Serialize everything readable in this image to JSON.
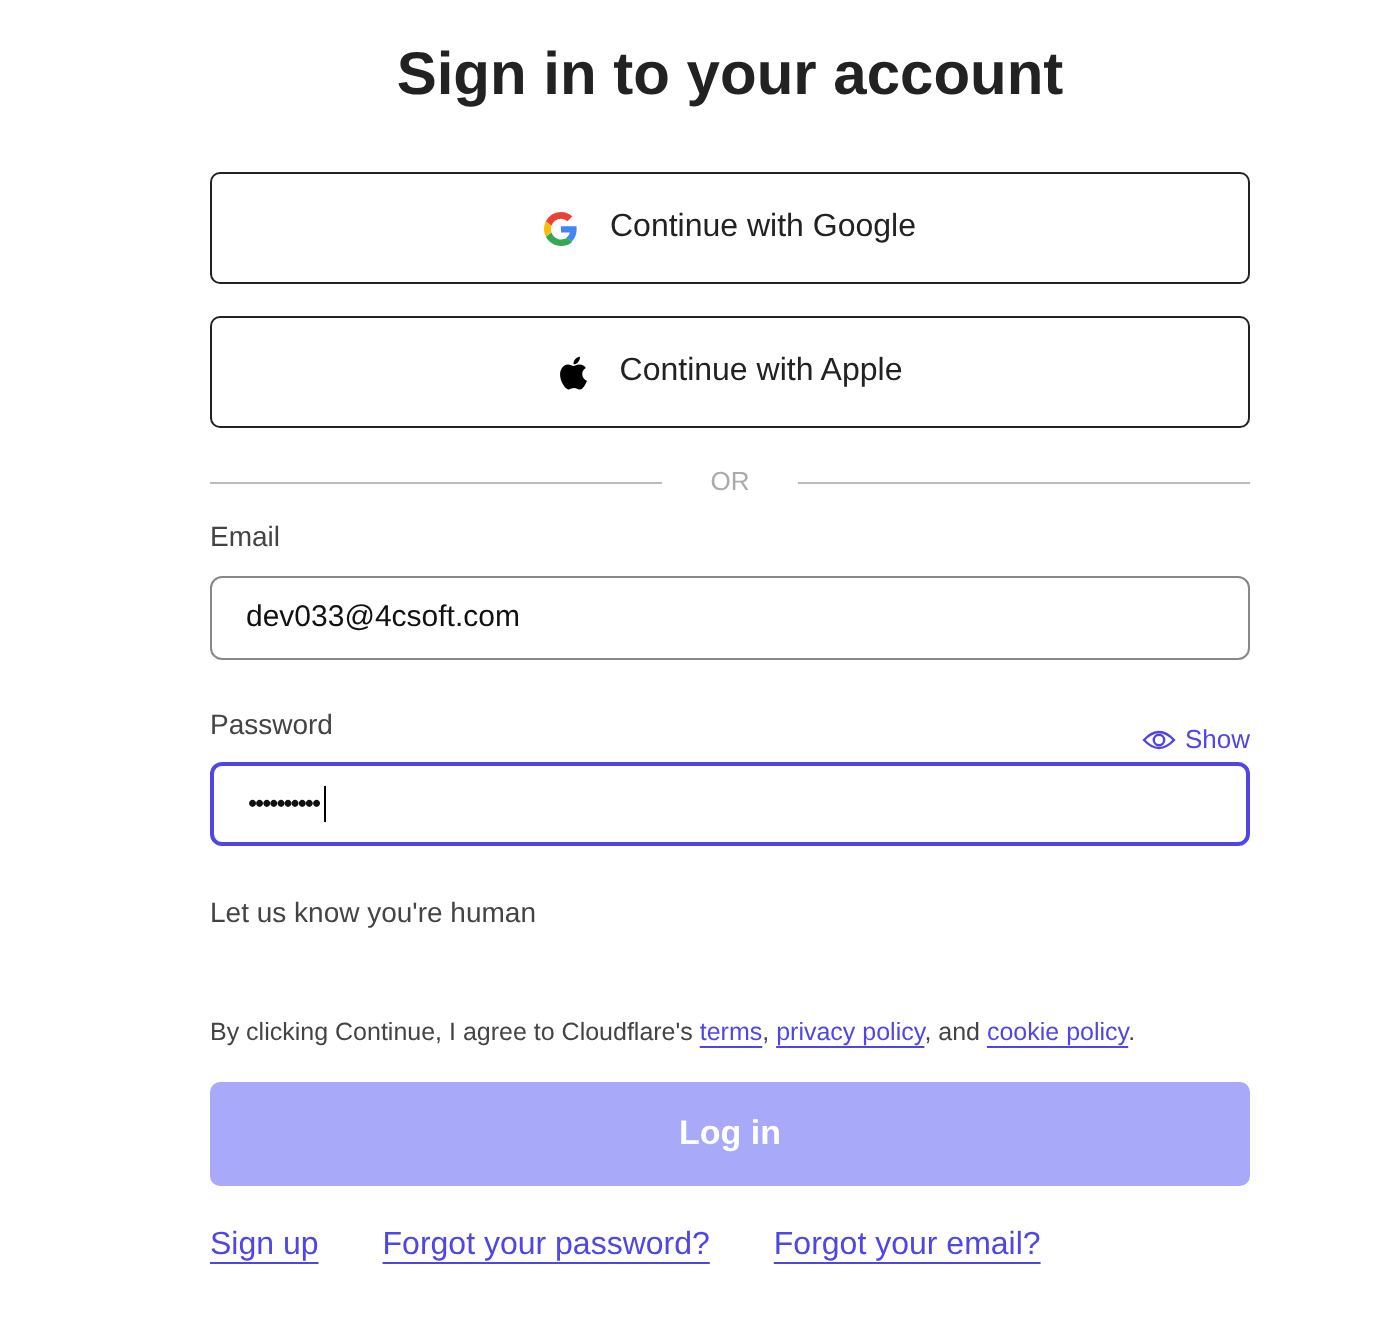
{
  "title": "Sign in to your account",
  "providers": [
    {
      "kind": "google",
      "label": "Continue with Google"
    },
    {
      "kind": "apple",
      "label": "Continue with Apple"
    }
  ],
  "divider": "OR",
  "email": {
    "label": "Email",
    "value": "dev033@4csoft.com",
    "focused": false
  },
  "password": {
    "label": "Password",
    "value": "••••••••••",
    "focused": true,
    "toggle": "Show"
  },
  "captcha_label": "Let us know you're human",
  "consent": [
    {
      "kind": "text",
      "text": "By clicking Continue, I agree to Cloudflare's "
    },
    {
      "kind": "link",
      "text": "terms"
    },
    {
      "kind": "text",
      "text": ", "
    },
    {
      "kind": "link",
      "text": "privacy policy"
    },
    {
      "kind": "text",
      "text": ", and "
    },
    {
      "kind": "link",
      "text": "cookie policy"
    },
    {
      "kind": "text",
      "text": "."
    }
  ],
  "submit": {
    "label": "Log in",
    "disabled": true
  },
  "links": [
    "Sign up",
    "Forgot your password?",
    "Forgot your email?"
  ]
}
